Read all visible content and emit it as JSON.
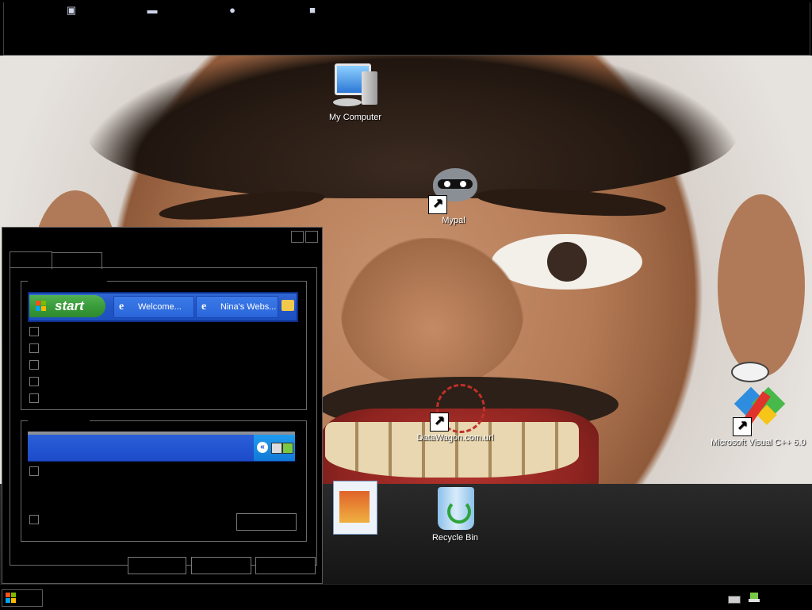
{
  "desktop": {
    "icons": {
      "my_computer": "My Computer",
      "mypal": "Mypal",
      "datawagon": "DataWagon.com.url",
      "visual_cpp": "Microsoft Visual C++ 6.0",
      "recycle_bin": "Recycle Bin"
    }
  },
  "top_bar": {
    "quick_launch": [
      "network-icon",
      "drive-icon",
      "user-icon",
      "document-icon"
    ]
  },
  "window": {
    "preview": {
      "start_label": "start",
      "task_buttons": [
        "Welcome...",
        "Nina's Webs..."
      ],
      "chevron": "«"
    }
  },
  "colors": {
    "xp_blue": "#2457c7",
    "start_green": "#3a9c3a",
    "window_bg": "#000000",
    "border_gray": "#6a6a6a"
  }
}
